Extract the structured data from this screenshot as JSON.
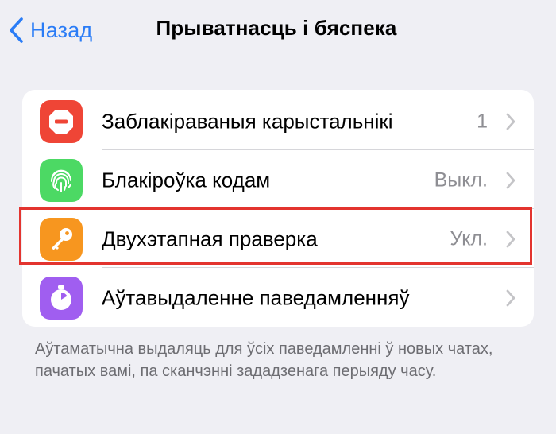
{
  "nav": {
    "back_label": "Назад",
    "title": "Прыватнасць і бяспека"
  },
  "settings": {
    "rows": [
      {
        "label": "Заблакіраваныя карыстальнікі",
        "value": "1",
        "icon": "no-entry-icon",
        "icon_color": "#ef4536"
      },
      {
        "label": "Блакіроўка кодам",
        "value": "Выкл.",
        "icon": "fingerprint-icon",
        "icon_color": "#4cd964"
      },
      {
        "label": "Двухэтапная праверка",
        "value": "Укл.",
        "icon": "key-icon",
        "icon_color": "#f7961f"
      },
      {
        "label": "Аўтавыдаленне паведамленняў",
        "value": "",
        "icon": "timer-icon",
        "icon_color": "#a05ef0"
      }
    ],
    "highlight_color": "#e3342f"
  },
  "footer": {
    "text": "Аўтаматычна выдаляць для ўсіх паведамленні ў новых чатах, пачатых вамі, па сканчэнні зададзенага перыяду часу."
  },
  "colors": {
    "accent": "#2a7cf6",
    "background": "#efeff4"
  }
}
